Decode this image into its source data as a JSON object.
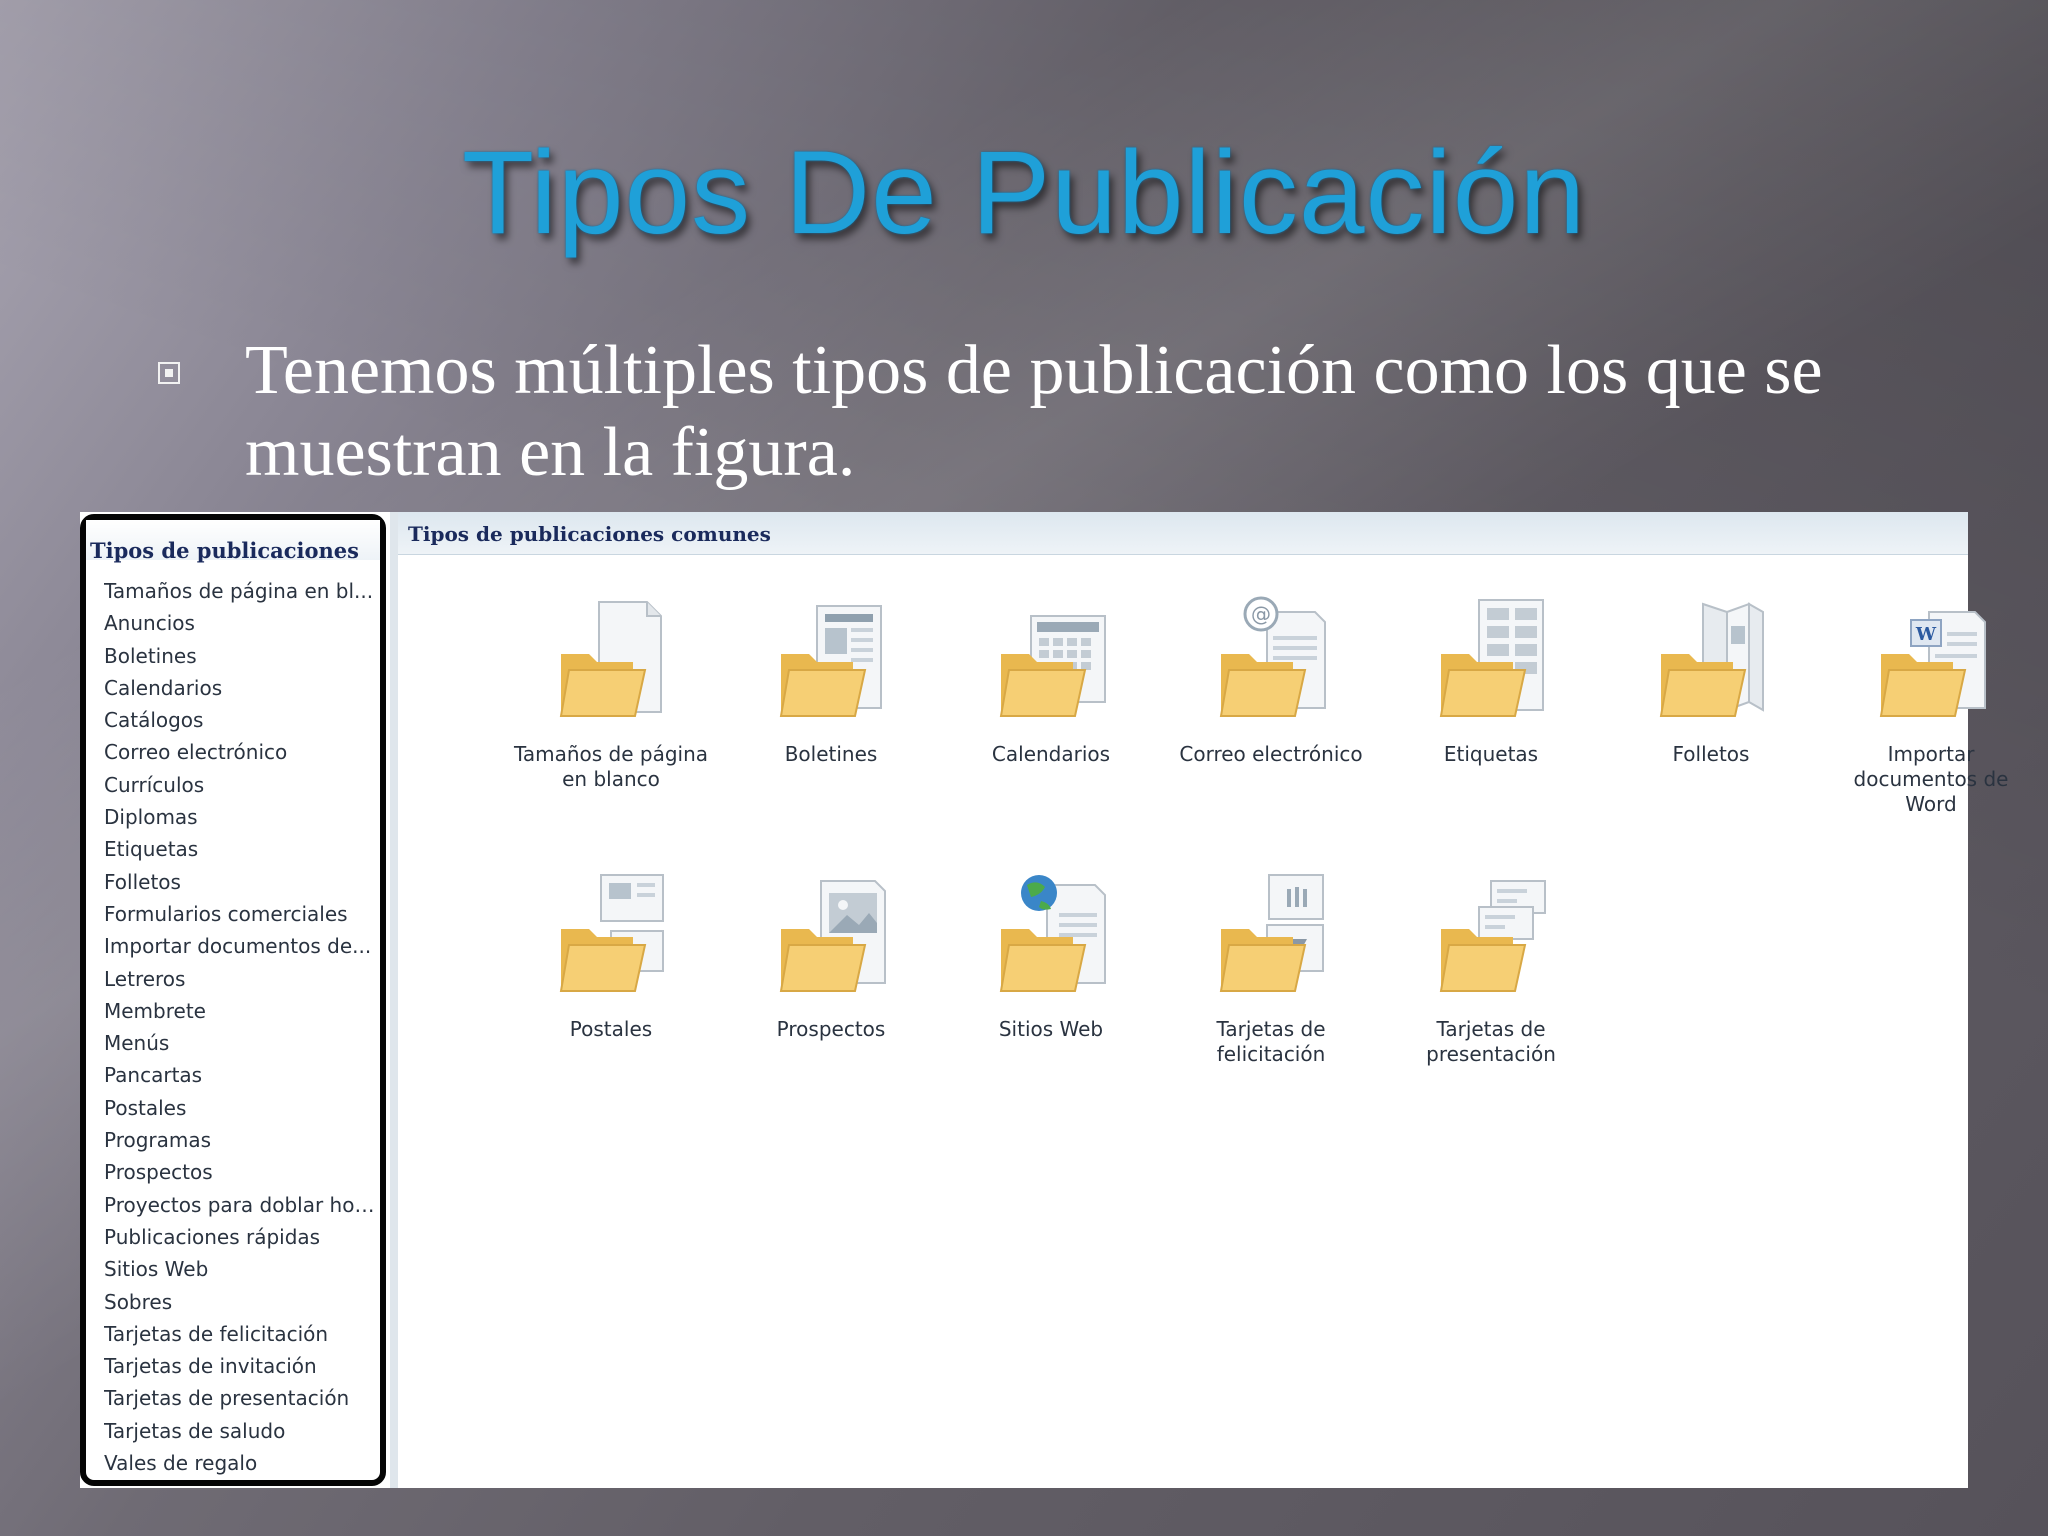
{
  "slide": {
    "title": "Tipos De Publicación",
    "bullet": "Tenemos múltiples tipos de publicación como los que se muestran en la figura."
  },
  "sidebar": {
    "title": "Tipos de publicaciones",
    "items": [
      "Tamaños de página en bl...",
      "Anuncios",
      "Boletines",
      "Calendarios",
      "Catálogos",
      "Correo electrónico",
      "Currículos",
      "Diplomas",
      "Etiquetas",
      "Folletos",
      "Formularios comerciales",
      "Importar documentos de...",
      "Letreros",
      "Membrete",
      "Menús",
      "Pancartas",
      "Postales",
      "Programas",
      "Prospectos",
      "Proyectos para doblar hojas",
      "Publicaciones rápidas",
      "Sitios Web",
      "Sobres",
      "Tarjetas de felicitación",
      "Tarjetas de invitación",
      "Tarjetas de presentación",
      "Tarjetas de saludo",
      "Vales de regalo"
    ]
  },
  "main": {
    "header": "Tipos de publicaciones comunes",
    "tiles": [
      {
        "label": "Tamaños de página en blanco",
        "icon": "blank-page-folder-icon"
      },
      {
        "label": "Boletines",
        "icon": "newsletter-folder-icon"
      },
      {
        "label": "Calendarios",
        "icon": "calendar-folder-icon"
      },
      {
        "label": "Correo electrónico",
        "icon": "email-folder-icon"
      },
      {
        "label": "Etiquetas",
        "icon": "labels-folder-icon"
      },
      {
        "label": "Folletos",
        "icon": "brochure-folder-icon"
      },
      {
        "label": "Importar documentos de Word",
        "icon": "import-word-folder-icon"
      },
      {
        "label": "Postales",
        "icon": "postcard-folder-icon"
      },
      {
        "label": "Prospectos",
        "icon": "flyer-folder-icon"
      },
      {
        "label": "Sitios Web",
        "icon": "website-folder-icon"
      },
      {
        "label": "Tarjetas de felicitación",
        "icon": "greeting-card-folder-icon"
      },
      {
        "label": "Tarjetas de presentación",
        "icon": "business-card-folder-icon"
      }
    ]
  },
  "colors": {
    "title": "#1fa0d8",
    "folder": "#f3c86a",
    "header_text": "#1a2a5c"
  }
}
